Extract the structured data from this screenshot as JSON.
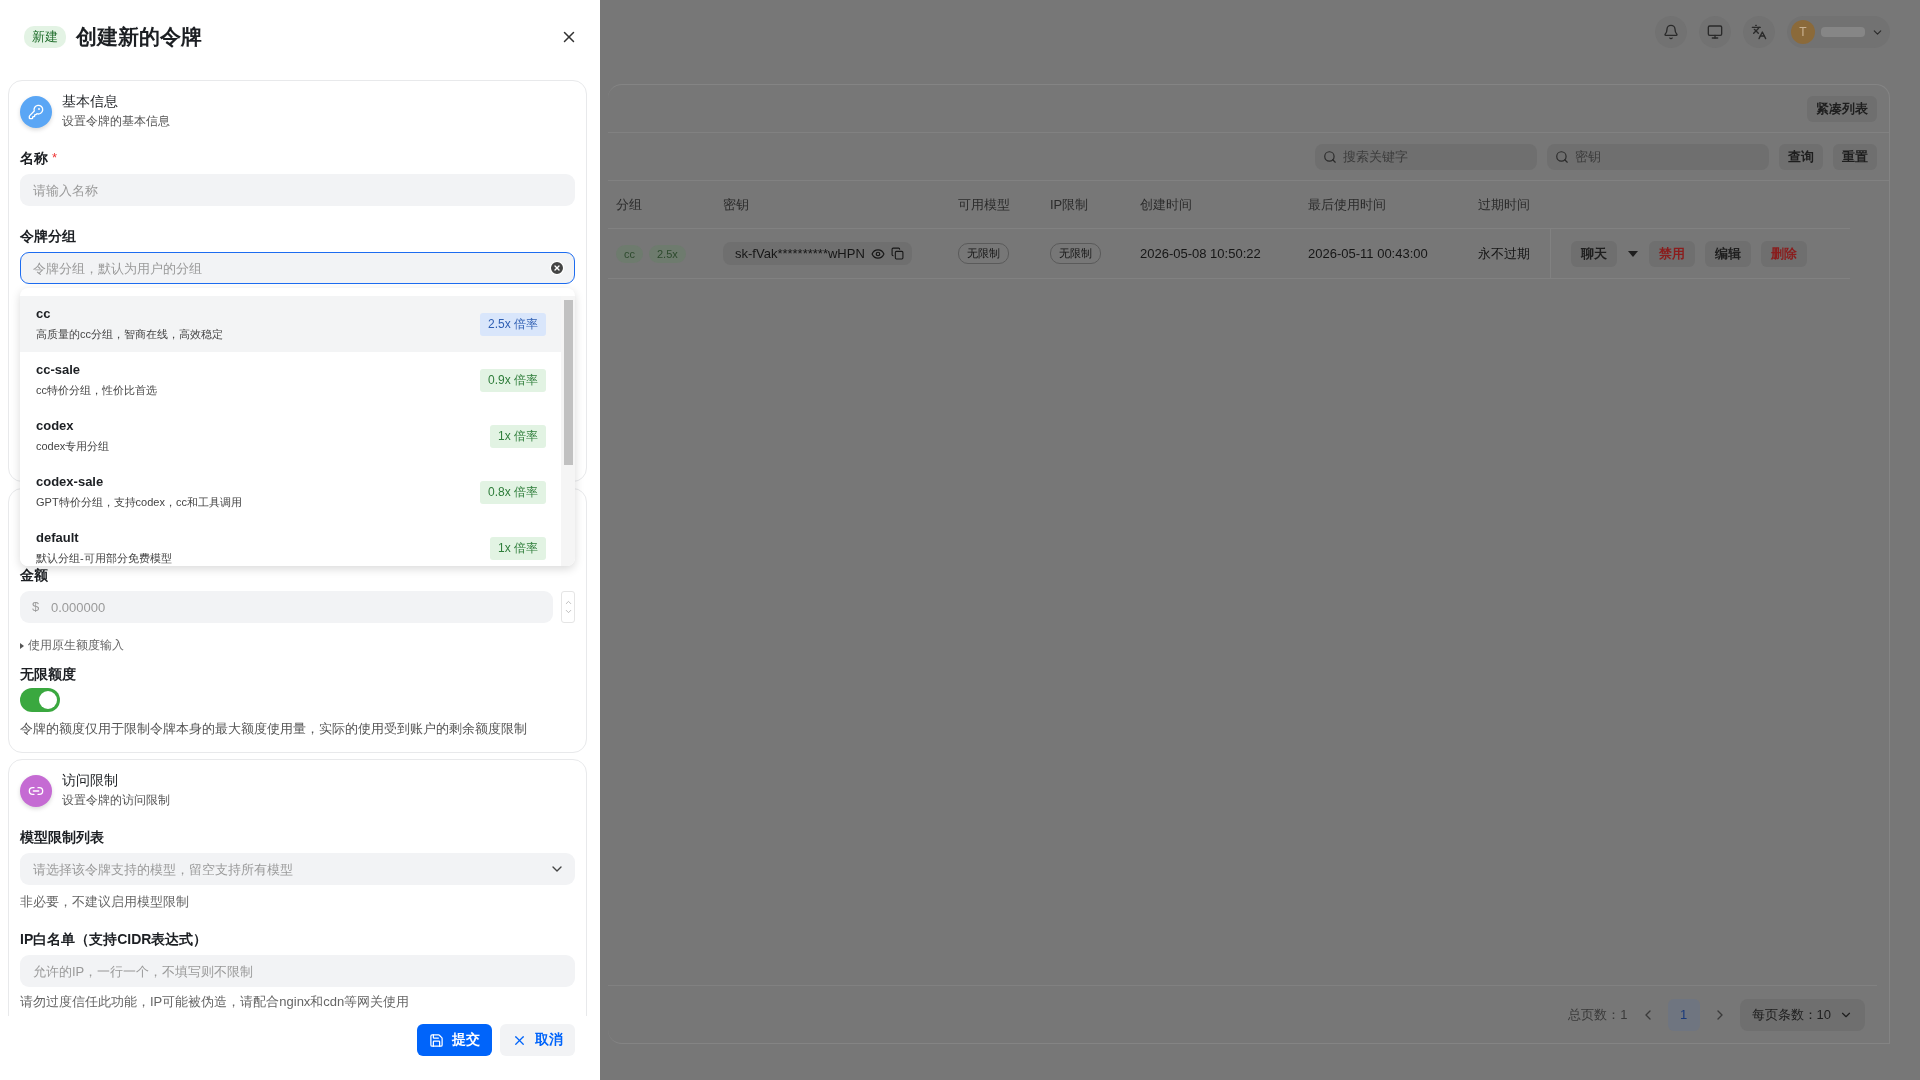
{
  "drawer": {
    "badge": "新建",
    "title": "创建新的令牌"
  },
  "basic": {
    "title": "基本信息",
    "subtitle": "设置令牌的基本信息",
    "name_field": {
      "label": "名称",
      "required_mark": "*",
      "placeholder": "请输入名称"
    },
    "group_field": {
      "label": "令牌分组",
      "placeholder": "令牌分组，默认为用户的分组",
      "focused": true,
      "options": [
        {
          "name": "cc",
          "desc": "高质量的cc分组，智商在线，高效稳定",
          "rate": "2.5x 倍率",
          "color": "#2f5fb3",
          "highlighted": true
        },
        {
          "name": "cc-sale",
          "desc": "cc特价分组，性价比首选",
          "rate": "0.9x 倍率",
          "color": "#2e7d3a",
          "highlighted": false
        },
        {
          "name": "codex",
          "desc": "codex专用分组",
          "rate": "1x 倍率",
          "color": "#2e7d3a",
          "highlighted": false
        },
        {
          "name": "codex-sale",
          "desc": "GPT特价分组，支持codex，cc和工具调用",
          "rate": "0.8x 倍率",
          "color": "#2e7d3a",
          "highlighted": false
        },
        {
          "name": "default",
          "desc": "默认分组-可用部分免费模型",
          "rate": "1x 倍率",
          "color": "#2e7d3a",
          "highlighted": false
        }
      ]
    }
  },
  "quota": {
    "amount_label": "金额",
    "currency": "$",
    "amount_placeholder": "0.000000",
    "native_toggle": {
      "label": "使用原生额度输入",
      "expanded": false
    },
    "unlimited_label": "无限额度",
    "unlimited_on": true,
    "note": "令牌的额度仅用于限制令牌本身的最大额度使用量，实际的使用受到账户的剩余额度限制"
  },
  "access": {
    "title": "访问限制",
    "subtitle": "设置令牌的访问限制",
    "model_label": "模型限制列表",
    "model_placeholder": "请选择该令牌支持的模型，留空支持所有模型",
    "model_hint": "非必要，不建议启用模型限制",
    "ip_label": "IP白名单（支持CIDR表达式）",
    "ip_placeholder": "允许的IP，一行一个，不填写则不限制",
    "ip_hint": "请勿过度信任此功能，IP可能被伪造，请配合nginx和cdn等网关使用"
  },
  "footer": {
    "submit": "提交",
    "cancel": "取消"
  },
  "page": {
    "avatar": "T",
    "compact_button": "紧凑列表",
    "search_placeholder": "搜索关键字",
    "key_placeholder": "密钥",
    "query": "查询",
    "reset": "重置",
    "columns": [
      "分组",
      "密钥",
      "可用模型",
      "IP限制",
      "创建时间",
      "最后使用时间",
      "过期时间"
    ],
    "rows": [
      {
        "groups": [
          "cc",
          "2.5x"
        ],
        "key": "sk-fVak**********wHPN",
        "models": "无限制",
        "ip": "无限制",
        "created": "2026-05-08 10:50:22",
        "last_used": "2026-05-11 00:43:00",
        "expires": "永不过期",
        "actions": [
          {
            "label": "聊天",
            "kind": "split"
          },
          {
            "label": "禁用",
            "kind": "danger"
          },
          {
            "label": "编辑",
            "kind": "neutral"
          },
          {
            "label": "删除",
            "kind": "danger"
          }
        ]
      }
    ],
    "pagination": {
      "total": "总页数：1",
      "pages": [
        {
          "label": "1",
          "selected": true
        }
      ],
      "per_page": "每页条数：10"
    }
  }
}
